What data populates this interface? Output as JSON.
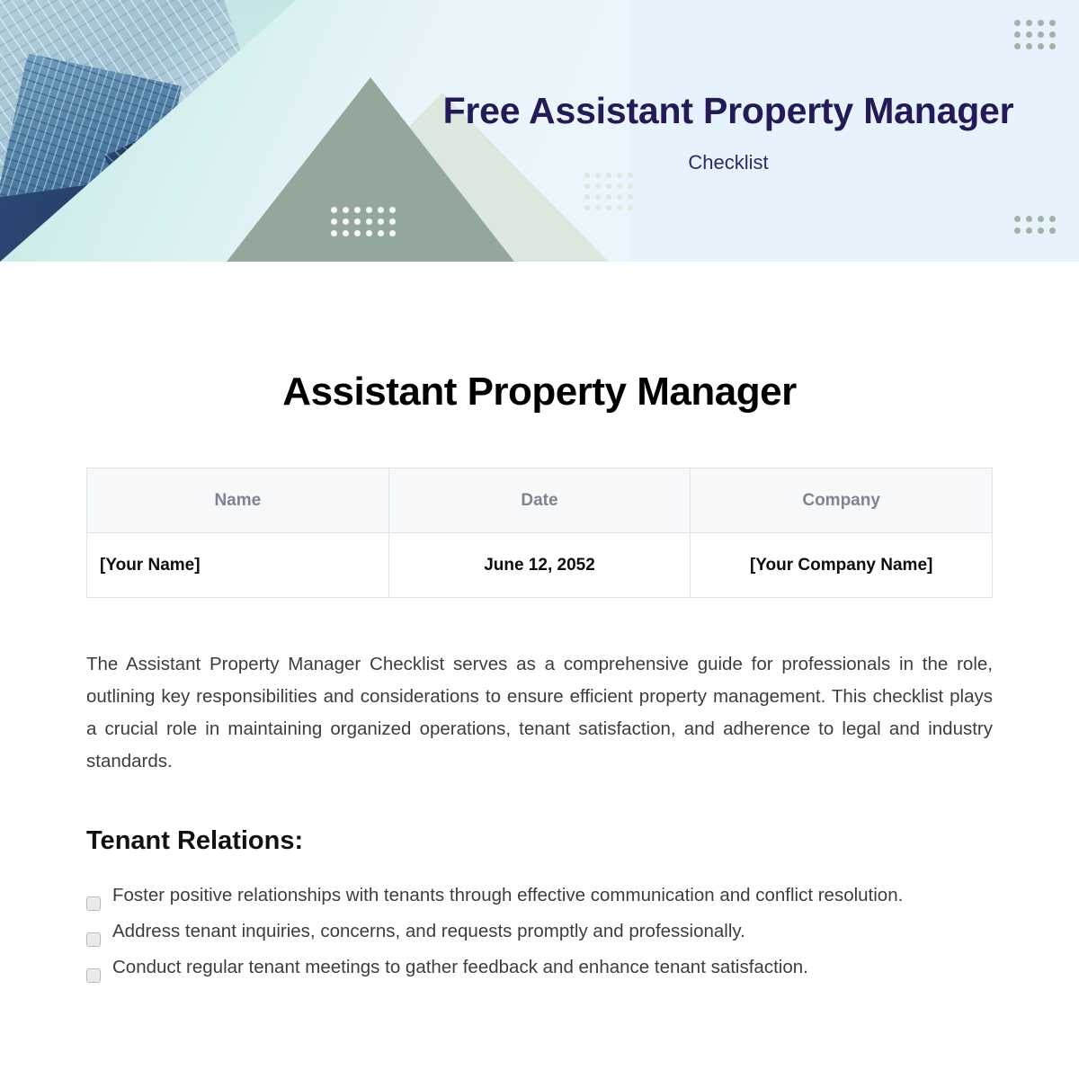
{
  "banner": {
    "title": "Free Assistant Property Manager",
    "subtitle": "Checklist",
    "title_color": "#231a56",
    "background_color": "#e7f3fc",
    "triangle_color": "#94a79c",
    "triangle_light_color": "#dce8de",
    "dot_color": "#9fb3a7",
    "photo_alt": "glass-skyscrapers-photo"
  },
  "document": {
    "title": "Assistant Property Manager",
    "info_table": {
      "headers": [
        "Name",
        "Date",
        "Company"
      ],
      "rows": [
        [
          "[Your Name]",
          "June 12, 2052",
          "[Your Company Name]"
        ]
      ]
    },
    "intro": "The Assistant Property Manager Checklist serves as a comprehensive guide for professionals in the role, outlining key responsibilities and considerations to ensure efficient property management. This checklist plays a crucial role in maintaining organized operations, tenant satisfaction, and adherence to legal and industry standards.",
    "sections": [
      {
        "heading": "Tenant Relations:",
        "items": [
          "Foster positive relationships with tenants through effective communication and conflict resolution.",
          "Address tenant inquiries, concerns, and requests promptly and professionally.",
          "Conduct regular tenant meetings to gather feedback and enhance tenant satisfaction."
        ]
      }
    ]
  }
}
